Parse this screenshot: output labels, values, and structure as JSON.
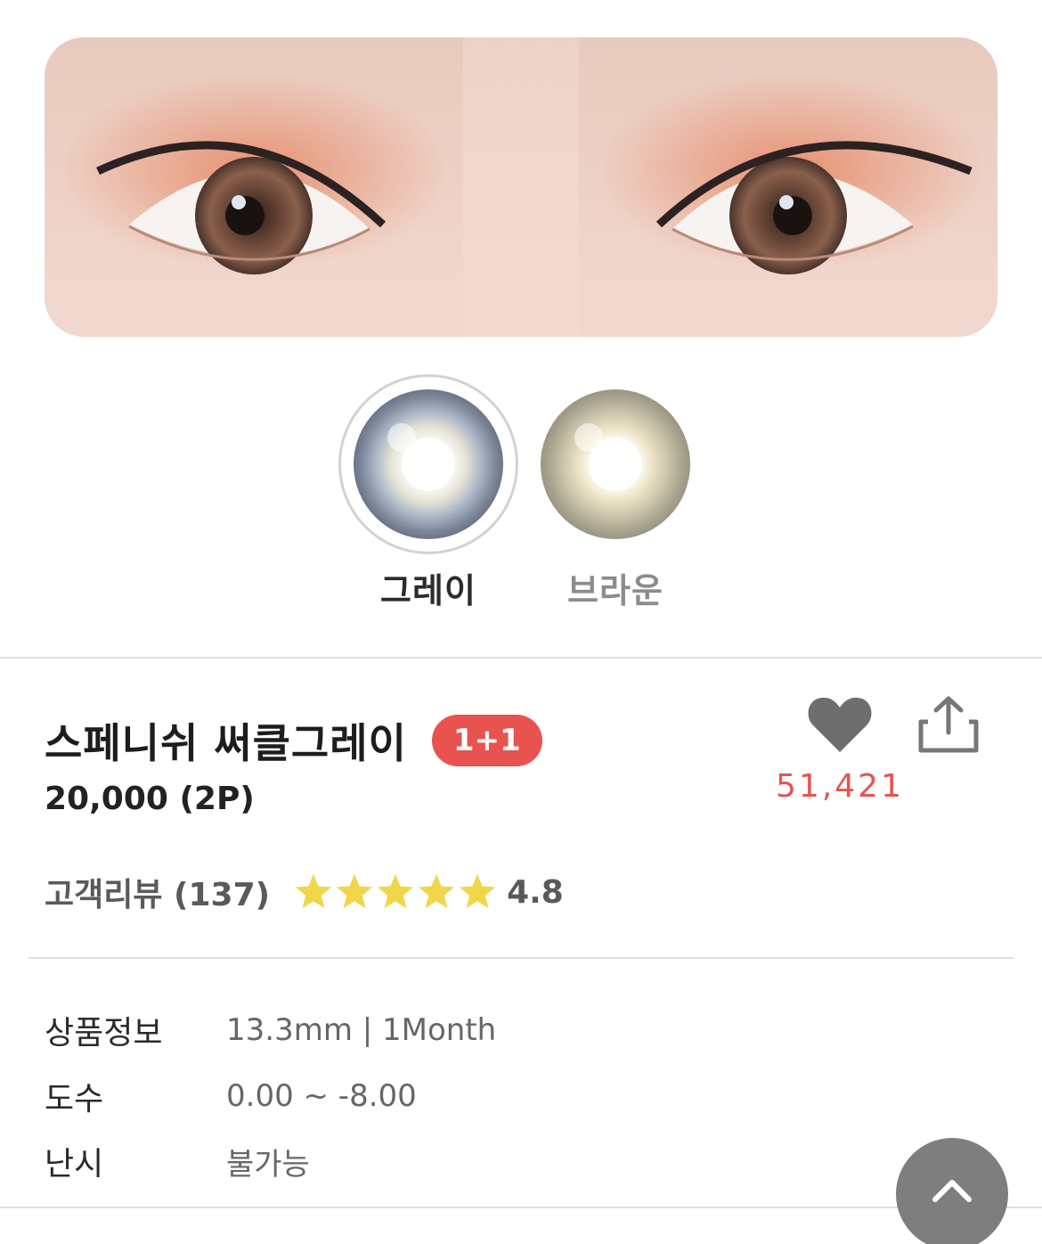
{
  "hero": {
    "image": "eye-model-photo"
  },
  "swatches": [
    {
      "label": "그레이",
      "selected": true,
      "color": "#8a93a6"
    },
    {
      "label": "브라운",
      "selected": false,
      "color": "#9f9b8a"
    }
  ],
  "product": {
    "title": "스페니쉬 써클그레이",
    "badge": "1+1",
    "price": "20,000 (2P)",
    "likes": "51,421",
    "review_label": "고객리뷰 (137)",
    "rating": "4.8",
    "stars": 5
  },
  "info": [
    {
      "key": "상품정보",
      "value": "13.3mm | 1Month"
    },
    {
      "key": "도수",
      "value": "0.00 ~ -8.00"
    },
    {
      "key": "난시",
      "value": "불가능"
    }
  ],
  "colors": {
    "accent": "#e9534f",
    "like_count": "#e55450",
    "star": "#f1d64a",
    "heart": "#6e6e6e",
    "fab": "#7e7e7e"
  },
  "icons": {
    "like": "heart-icon",
    "share": "share-icon",
    "scroll_top": "chevron-up-icon",
    "star": "star-icon"
  }
}
